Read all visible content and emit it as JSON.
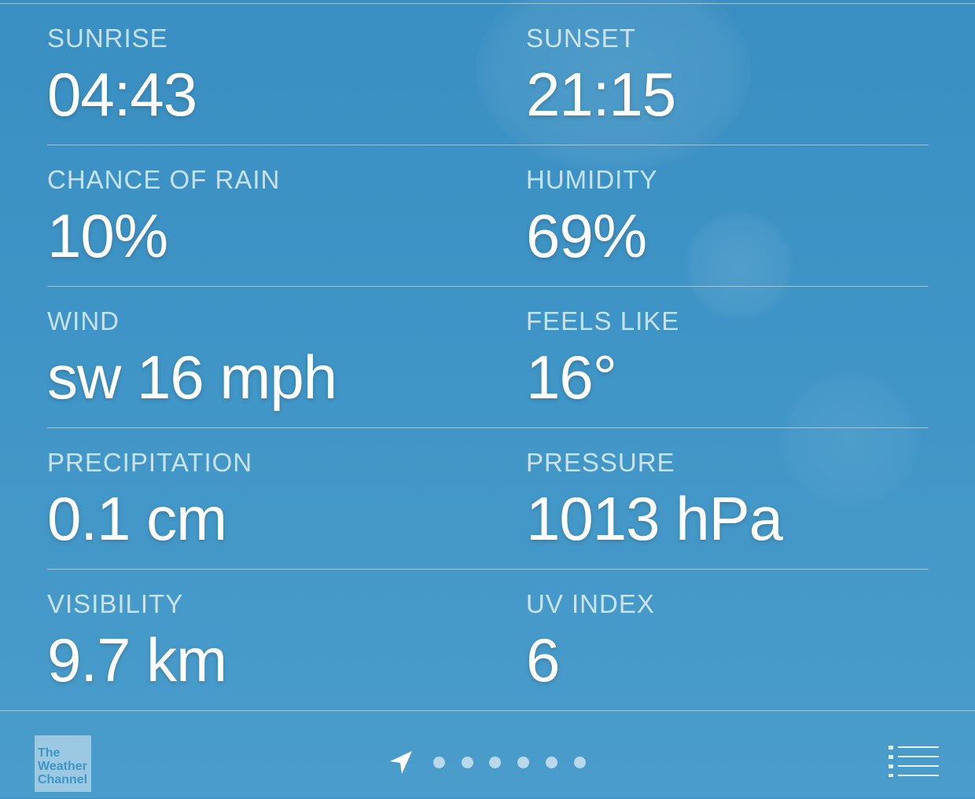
{
  "details": {
    "rows": [
      [
        {
          "label": "SUNRISE",
          "value": "04:43"
        },
        {
          "label": "SUNSET",
          "value": "21:15"
        }
      ],
      [
        {
          "label": "CHANCE OF RAIN",
          "value": "10%"
        },
        {
          "label": "HUMIDITY",
          "value": "69%"
        }
      ],
      [
        {
          "label": "WIND",
          "value": "sw 16 mph"
        },
        {
          "label": "FEELS LIKE",
          "value": "16°"
        }
      ],
      [
        {
          "label": "PRECIPITATION",
          "value": "0.1 cm"
        },
        {
          "label": "PRESSURE",
          "value": "1013 hPa"
        }
      ],
      [
        {
          "label": "VISIBILITY",
          "value": "9.7 km"
        },
        {
          "label": "UV INDEX",
          "value": "6"
        }
      ]
    ]
  },
  "footer": {
    "logo": {
      "line1": "The",
      "line2": "Weather",
      "line3": "Channel"
    },
    "page_count": 6,
    "current_page": "location",
    "icons": {
      "location": "location-arrow-icon",
      "menu": "list-icon"
    }
  }
}
